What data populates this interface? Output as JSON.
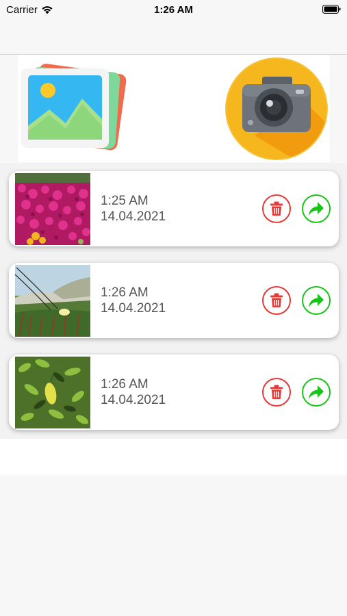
{
  "status_bar": {
    "carrier": "Carrier",
    "time": "1:26 AM"
  },
  "colors": {
    "delete": "#e53935",
    "share": "#19c419",
    "text": "#555555"
  },
  "actions": {
    "gallery_icon": "gallery-icon",
    "camera_icon": "camera-icon"
  },
  "photos": [
    {
      "time": "1:25 AM",
      "date": "14.04.2021",
      "thumbnail": "pink-flowers",
      "delete_icon": "trash-icon",
      "share_icon": "share-arrow-icon"
    },
    {
      "time": "1:26 AM",
      "date": "14.04.2021",
      "thumbnail": "dunes-plants",
      "delete_icon": "trash-icon",
      "share_icon": "share-arrow-icon"
    },
    {
      "time": "1:26 AM",
      "date": "14.04.2021",
      "thumbnail": "green-leaves",
      "delete_icon": "trash-icon",
      "share_icon": "share-arrow-icon"
    }
  ]
}
